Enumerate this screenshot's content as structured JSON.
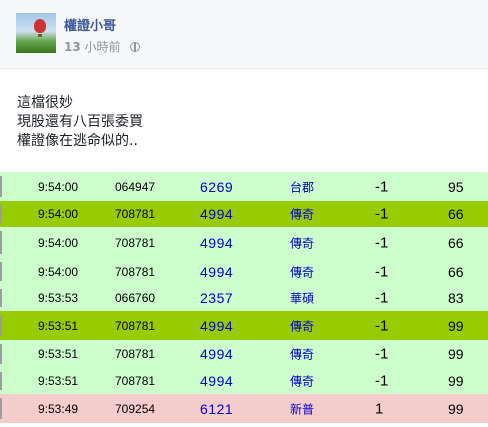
{
  "author": {
    "name": "權證小哥"
  },
  "meta": {
    "time_number": "13",
    "time_unit": "小時前",
    "privacy_icon": "globe-icon"
  },
  "post": {
    "lines": [
      "這檔很妙",
      "現股還有八百張委買",
      "權證像在逃命似的.."
    ]
  },
  "colors": {
    "row_green": "#ccffcc",
    "row_highlight": "#99cc00",
    "row_pink": "#f4cccc",
    "code_blue": "#0000cc"
  },
  "trades": [
    {
      "time": "9:54:00",
      "id": "064947",
      "code": "6269",
      "stock": "台郡",
      "change": "-1",
      "volume": "95",
      "style": "green"
    },
    {
      "time": "9:54:00",
      "id": "708781",
      "code": "4994",
      "stock": "傳奇",
      "change": "-1",
      "volume": "66",
      "style": "highlight"
    },
    {
      "time": "9:54:00",
      "id": "708781",
      "code": "4994",
      "stock": "傳奇",
      "change": "-1",
      "volume": "66",
      "style": "green"
    },
    {
      "time": "9:54:00",
      "id": "708781",
      "code": "4994",
      "stock": "傳奇",
      "change": "-1",
      "volume": "66",
      "style": "green"
    },
    {
      "time": "9:53:53",
      "id": "066760",
      "code": "2357",
      "stock": "華碩",
      "change": "-1",
      "volume": "83",
      "style": "green"
    },
    {
      "time": "9:53:51",
      "id": "708781",
      "code": "4994",
      "stock": "傳奇",
      "change": "-1",
      "volume": "99",
      "style": "highlight"
    },
    {
      "time": "9:53:51",
      "id": "708781",
      "code": "4994",
      "stock": "傳奇",
      "change": "-1",
      "volume": "99",
      "style": "green"
    },
    {
      "time": "9:53:51",
      "id": "708781",
      "code": "4994",
      "stock": "傳奇",
      "change": "-1",
      "volume": "99",
      "style": "green"
    },
    {
      "time": "9:53:49",
      "id": "709254",
      "code": "6121",
      "stock": "新普",
      "change": "1",
      "volume": "99",
      "style": "pink"
    }
  ]
}
